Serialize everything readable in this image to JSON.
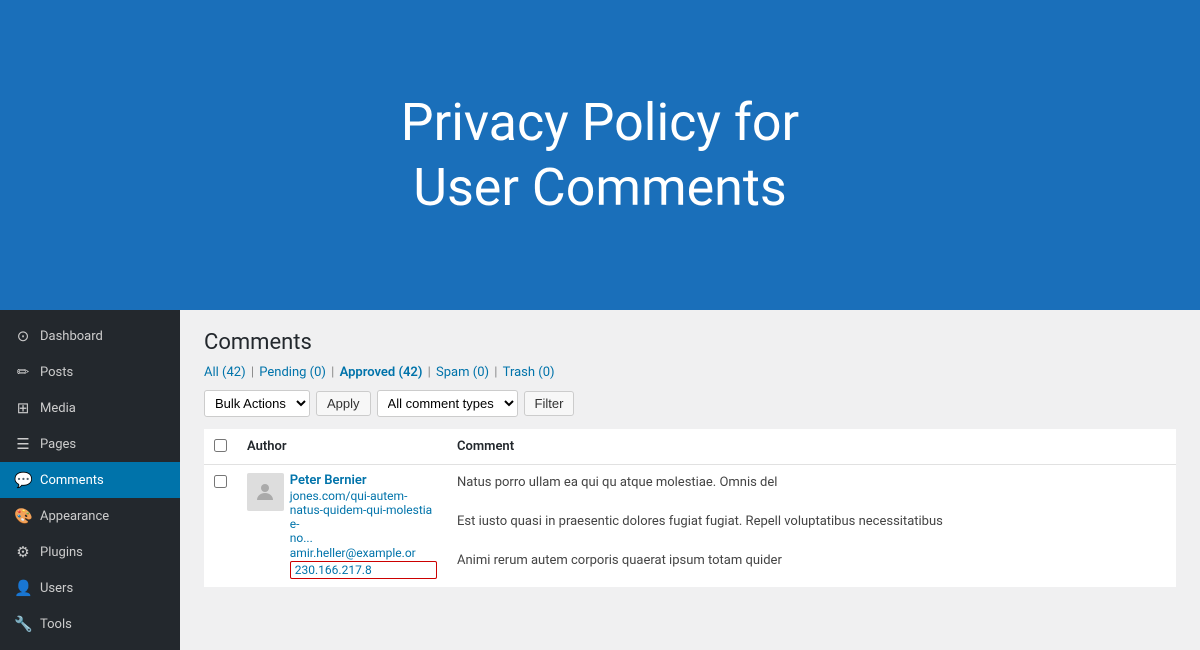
{
  "hero": {
    "title_line1": "Privacy Policy for",
    "title_line2": "User Comments"
  },
  "sidebar": {
    "items": [
      {
        "id": "dashboard",
        "label": "Dashboard",
        "icon": "⊙",
        "active": false
      },
      {
        "id": "posts",
        "label": "Posts",
        "icon": "✎",
        "active": false
      },
      {
        "id": "media",
        "label": "Media",
        "icon": "⊞",
        "active": false
      },
      {
        "id": "pages",
        "label": "Pages",
        "icon": "☰",
        "active": false
      },
      {
        "id": "comments",
        "label": "Comments",
        "icon": "💬",
        "active": true
      },
      {
        "id": "appearance",
        "label": "Appearance",
        "icon": "🎨",
        "active": false
      },
      {
        "id": "plugins",
        "label": "Plugins",
        "icon": "⚙",
        "active": false
      },
      {
        "id": "users",
        "label": "Users",
        "icon": "👤",
        "active": false
      },
      {
        "id": "tools",
        "label": "Tools",
        "icon": "🔧",
        "active": false
      }
    ]
  },
  "main": {
    "page_title": "Comments",
    "filter_links": [
      {
        "label": "All",
        "count": "42",
        "active": true
      },
      {
        "label": "Pending",
        "count": "0",
        "active": false
      },
      {
        "label": "Approved",
        "count": "42",
        "active": false
      },
      {
        "label": "Spam",
        "count": "0",
        "active": false
      },
      {
        "label": "Trash",
        "count": "0",
        "active": false
      }
    ],
    "bulk_actions_label": "Bulk Actions",
    "apply_label": "Apply",
    "comment_types_label": "All comment types",
    "filter_label": "Filter",
    "table": {
      "headers": [
        "",
        "Author",
        "Comment"
      ],
      "rows": [
        {
          "author_name": "Peter Bernier",
          "author_link": "jones.com/qui-autem-natus-quidem-qui-molestiae-no...",
          "author_email": "amir.heller@example.or",
          "author_ip": "230.166.217.8",
          "comment": "Natus porro ullam ea qui qu atque molestiae. Omnis del Est iusto quasi in praesentic dolores fugiat fugiat. Repell voluptatibus necessitatibus Animi rerum autem corporis quaerat ipsum totam quider"
        }
      ]
    }
  }
}
